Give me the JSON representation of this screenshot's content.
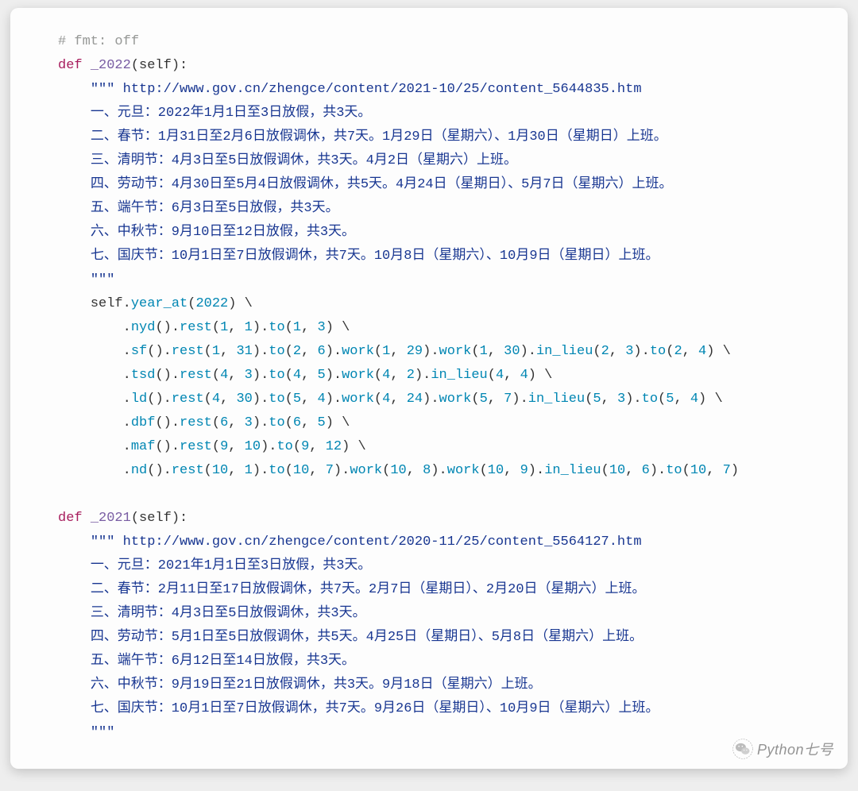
{
  "code": {
    "comment_fmt": "# fmt: off",
    "fn2022": {
      "def_kw": "def",
      "name": "_2022",
      "sig": "(self):",
      "doc_open": "\"\"\"",
      "doc_url": " http://www.gov.cn/zhengce/content/2021-10/25/content_5644835.htm",
      "doc_lines": [
        "一、元旦：2022年1月1日至3日放假，共3天。",
        "二、春节：1月31日至2月6日放假调休，共7天。1月29日（星期六）、1月30日（星期日）上班。",
        "三、清明节：4月3日至5日放假调休，共3天。4月2日（星期六）上班。",
        "四、劳动节：4月30日至5月4日放假调休，共5天。4月24日（星期日）、5月7日（星期六）上班。",
        "五、端午节：6月3日至5日放假，共3天。",
        "六、中秋节：9月10日至12日放假，共3天。",
        "七、国庆节：10月1日至7日放假调休，共7天。10月8日（星期六）、10月9日（星期日）上班。"
      ],
      "doc_close": "\"\"\"",
      "chain_start_self": "self",
      "chain_start_year_at": "year_at",
      "chain_start_year": "2022",
      "chain_lines": [
        [
          {
            "m": "nyd",
            "a": []
          },
          {
            "m": "rest",
            "a": [
              "1",
              "1"
            ]
          },
          {
            "m": "to",
            "a": [
              "1",
              "3"
            ]
          }
        ],
        [
          {
            "m": "sf",
            "a": []
          },
          {
            "m": "rest",
            "a": [
              "1",
              "31"
            ]
          },
          {
            "m": "to",
            "a": [
              "2",
              "6"
            ]
          },
          {
            "m": "work",
            "a": [
              "1",
              "29"
            ]
          },
          {
            "m": "work",
            "a": [
              "1",
              "30"
            ]
          },
          {
            "m": "in_lieu",
            "a": [
              "2",
              "3"
            ]
          },
          {
            "m": "to",
            "a": [
              "2",
              "4"
            ]
          }
        ],
        [
          {
            "m": "tsd",
            "a": []
          },
          {
            "m": "rest",
            "a": [
              "4",
              "3"
            ]
          },
          {
            "m": "to",
            "a": [
              "4",
              "5"
            ]
          },
          {
            "m": "work",
            "a": [
              "4",
              "2"
            ]
          },
          {
            "m": "in_lieu",
            "a": [
              "4",
              "4"
            ]
          }
        ],
        [
          {
            "m": "ld",
            "a": []
          },
          {
            "m": "rest",
            "a": [
              "4",
              "30"
            ]
          },
          {
            "m": "to",
            "a": [
              "5",
              "4"
            ]
          },
          {
            "m": "work",
            "a": [
              "4",
              "24"
            ]
          },
          {
            "m": "work",
            "a": [
              "5",
              "7"
            ]
          },
          {
            "m": "in_lieu",
            "a": [
              "5",
              "3"
            ]
          },
          {
            "m": "to",
            "a": [
              "5",
              "4"
            ]
          }
        ],
        [
          {
            "m": "dbf",
            "a": []
          },
          {
            "m": "rest",
            "a": [
              "6",
              "3"
            ]
          },
          {
            "m": "to",
            "a": [
              "6",
              "5"
            ]
          }
        ],
        [
          {
            "m": "maf",
            "a": []
          },
          {
            "m": "rest",
            "a": [
              "9",
              "10"
            ]
          },
          {
            "m": "to",
            "a": [
              "9",
              "12"
            ]
          }
        ],
        [
          {
            "m": "nd",
            "a": []
          },
          {
            "m": "rest",
            "a": [
              "10",
              "1"
            ]
          },
          {
            "m": "to",
            "a": [
              "10",
              "7"
            ]
          },
          {
            "m": "work",
            "a": [
              "10",
              "8"
            ]
          },
          {
            "m": "work",
            "a": [
              "10",
              "9"
            ]
          },
          {
            "m": "in_lieu",
            "a": [
              "10",
              "6"
            ]
          },
          {
            "m": "to",
            "a": [
              "10",
              "7"
            ]
          }
        ]
      ]
    },
    "fn2021": {
      "def_kw": "def",
      "name": "_2021",
      "sig": "(self):",
      "doc_open": "\"\"\"",
      "doc_url": " http://www.gov.cn/zhengce/content/2020-11/25/content_5564127.htm",
      "doc_lines": [
        "一、元旦：2021年1月1日至3日放假，共3天。",
        "二、春节：2月11日至17日放假调休，共7天。2月7日（星期日）、2月20日（星期六）上班。",
        "三、清明节：4月3日至5日放假调休，共3天。",
        "四、劳动节：5月1日至5日放假调休，共5天。4月25日（星期日）、5月8日（星期六）上班。",
        "五、端午节：6月12日至14日放假，共3天。",
        "六、中秋节：9月19日至21日放假调休，共3天。9月18日（星期六）上班。",
        "七、国庆节：10月1日至7日放假调休，共7天。9月26日（星期日）、10月9日（星期六）上班。"
      ],
      "doc_close": "\"\"\""
    }
  },
  "watermark": {
    "text": "Python七号"
  }
}
